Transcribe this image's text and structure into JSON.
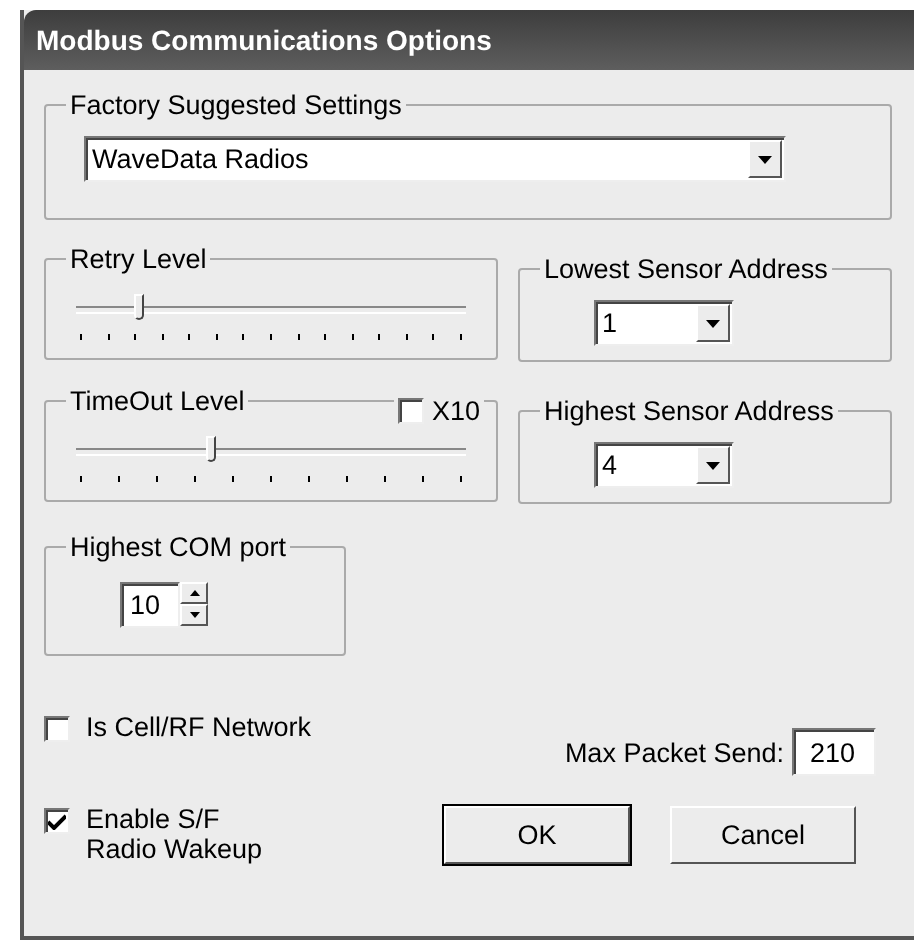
{
  "window": {
    "title": "Modbus Communications Options"
  },
  "factory_settings": {
    "label": "Factory Suggested Settings",
    "value": "WaveData Radios"
  },
  "retry_level": {
    "label": "Retry Level",
    "level": 0.15
  },
  "lowest_sensor_address": {
    "label": "Lowest Sensor Address",
    "value": "1"
  },
  "timeout_level": {
    "label": "TimeOut Level",
    "level": 0.34,
    "x10": {
      "label": "X10",
      "checked": false
    }
  },
  "highest_sensor_address": {
    "label": "Highest Sensor Address",
    "value": "4"
  },
  "highest_com_port": {
    "label": "Highest COM port",
    "value": "10"
  },
  "is_cell_rf_network": {
    "label": "Is Cell/RF Network",
    "checked": false
  },
  "max_packet_send": {
    "label": "Max Packet Send:",
    "value": "210"
  },
  "enable_sf_radio_wakeup": {
    "label": "Enable S/F Radio Wakeup",
    "checked": true
  },
  "buttons": [
    {
      "label": "OK",
      "default": true
    },
    {
      "label": "Cancel",
      "default": false
    }
  ]
}
